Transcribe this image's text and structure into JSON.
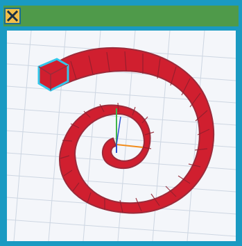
{
  "window": {
    "close_icon": "close-icon",
    "colors": {
      "frame": "#1a9ac2",
      "titlebar": "#4f9a4a",
      "close_button": "#f2bf4a",
      "close_glyph": "#1a2f45",
      "grid_background": "#f4f6fa",
      "grid_lines": "#cdd6e2",
      "shape_red": "#d01f2f",
      "shape_outline": "#9b2b3a",
      "selection_highlight": "#33c7ea"
    }
  },
  "scene": {
    "object": "red-spiral-blocks",
    "axes_gizmo": {
      "x": "#f28c1b",
      "y": "#3fb64b",
      "z": "#2f51d0"
    },
    "selected_block": "end-cube"
  }
}
